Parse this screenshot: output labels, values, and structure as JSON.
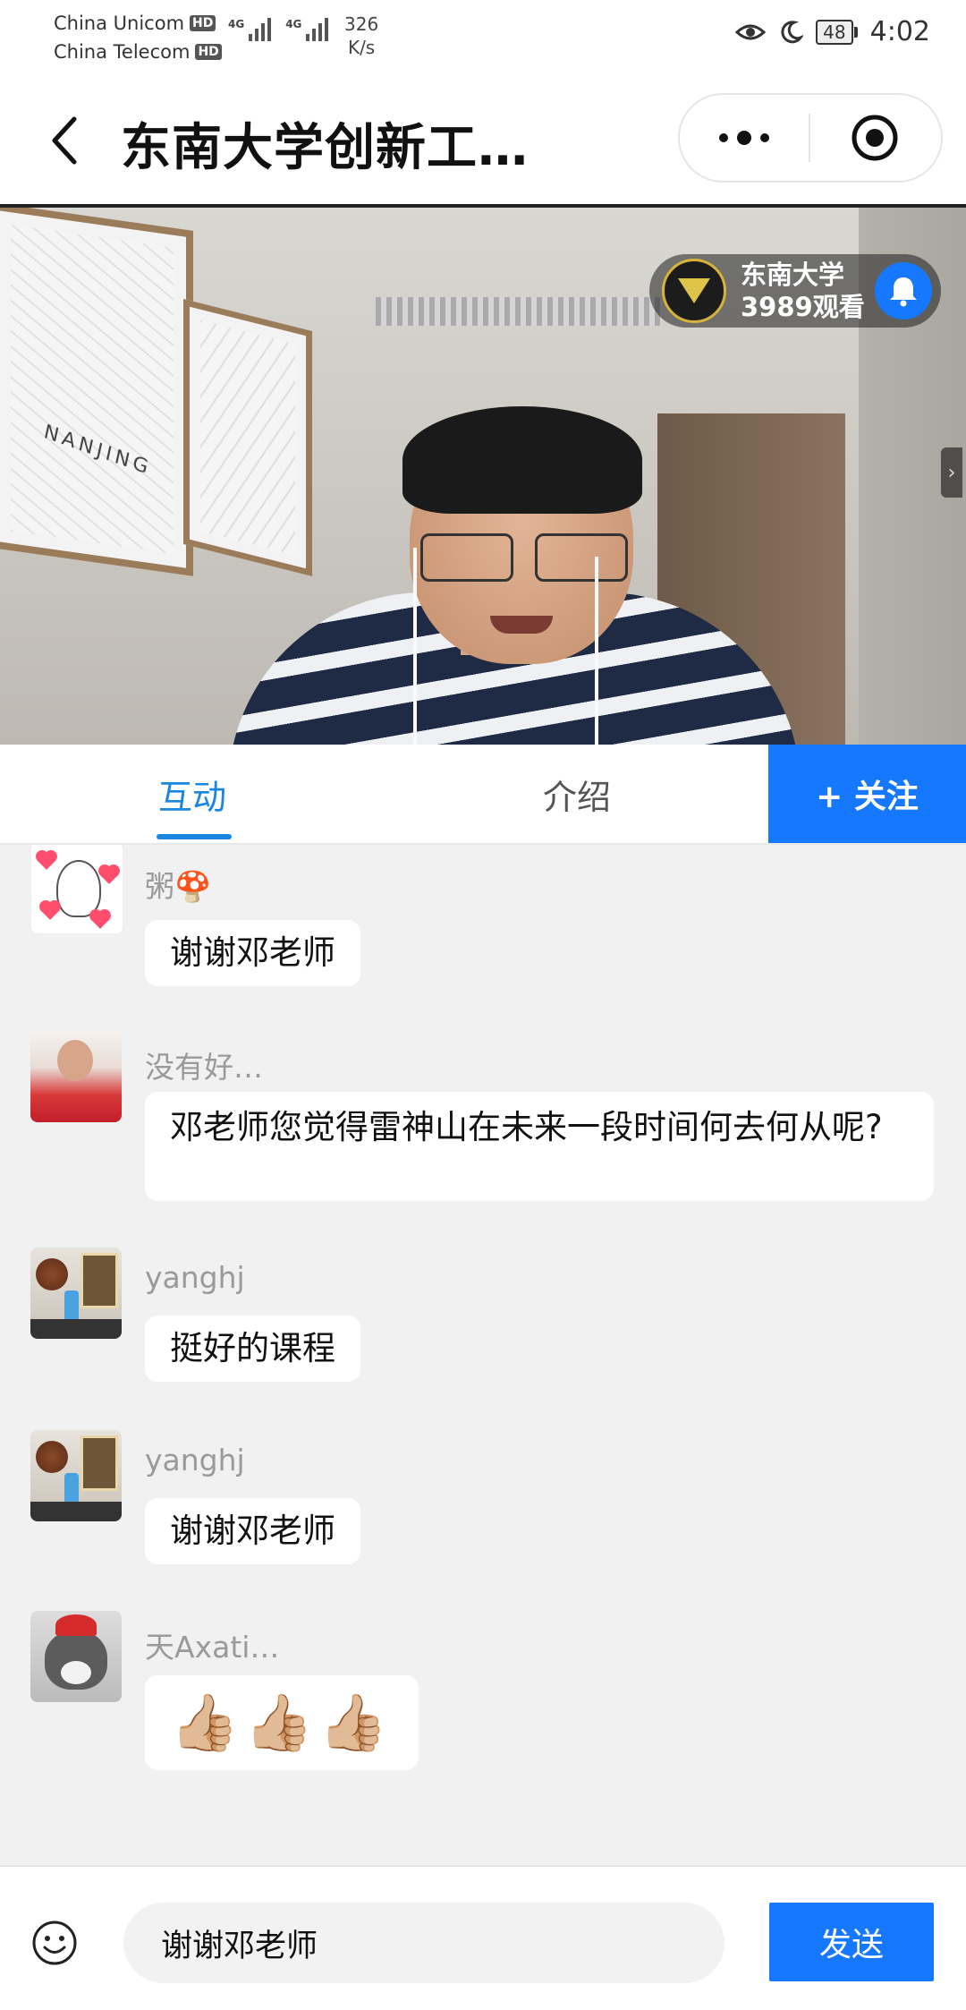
{
  "status_bar": {
    "carrier1": "China Unicom",
    "carrier2": "China Telecom",
    "hd_badge": "HD",
    "network1": "4G",
    "network2": "4G",
    "speed_value": "326",
    "speed_unit": "K/s",
    "battery": "48",
    "time": "4:02",
    "icons": [
      "eye-icon",
      "moon-icon",
      "battery-icon"
    ]
  },
  "header": {
    "title": "东南大学创新工…",
    "back_icon": "chevron-left-icon",
    "more_icon": "more-dots-icon",
    "close_icon": "target-circle-icon"
  },
  "live": {
    "host_name": "东南大学",
    "viewers": "3989观看",
    "bell_icon": "bell-icon",
    "side_handle": "›"
  },
  "tabs": {
    "interaction": "互动",
    "intro": "介绍",
    "follow": "+ 关注"
  },
  "messages": [
    {
      "user": "粥🍄",
      "text": "谢谢邓老师"
    },
    {
      "user": "没有好…",
      "text": "邓老师您觉得雷神山在未来一段时间何去何从呢?"
    },
    {
      "user": "yanghj",
      "text": "挺好的课程"
    },
    {
      "user": "yanghj",
      "text": "谢谢邓老师"
    },
    {
      "user": "天Axati…",
      "text": "👍🏼👍🏼👍🏼"
    }
  ],
  "composer": {
    "value": "谢谢邓老师",
    "send_label": "发送",
    "emoji_icon": "smiley-icon"
  },
  "colors": {
    "accent": "#1677ff",
    "tab_active": "#1a86e0",
    "chat_bg": "#f1f1f1"
  }
}
